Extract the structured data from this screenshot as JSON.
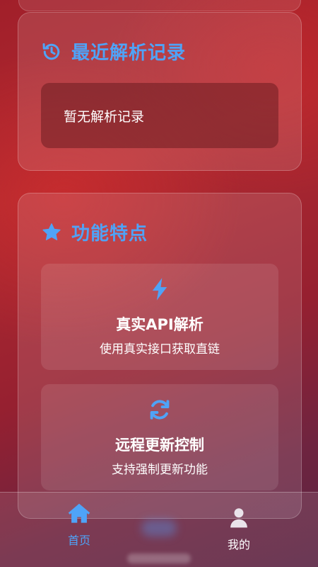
{
  "recent": {
    "title": "最近解析记录",
    "empty_text": "暂无解析记录"
  },
  "features": {
    "title": "功能特点",
    "items": [
      {
        "icon": "bolt-icon",
        "title": "真实API解析",
        "desc": "使用真实接口获取直链"
      },
      {
        "icon": "sync-icon",
        "title": "远程更新控制",
        "desc": "支持强制更新功能"
      }
    ]
  },
  "nav": {
    "home_label": "首页",
    "mine_label": "我的",
    "active": "home"
  },
  "colors": {
    "accent": "#4fa3f7",
    "text": "#ffffff",
    "background_primary": "#b02a30",
    "background_secondary": "#5a2342"
  }
}
